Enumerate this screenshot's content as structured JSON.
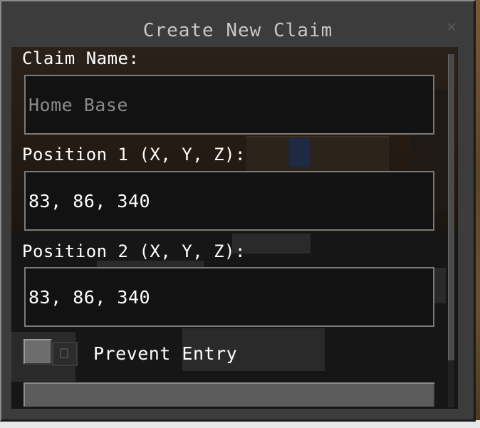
{
  "dialog": {
    "title": "Create New Claim",
    "close_icon": "close-icon"
  },
  "form": {
    "claim_name": {
      "label": "Claim Name:",
      "value": "",
      "placeholder": "Home Base"
    },
    "position1": {
      "label": "Position 1 (X, Y, Z):",
      "value": "83, 86, 340"
    },
    "position2": {
      "label": "Position 2 (X, Y, Z):",
      "value": "83, 86, 340"
    },
    "prevent_entry": {
      "label": "Prevent Entry",
      "checked": false
    }
  },
  "colors": {
    "panel": "#3c3c3c",
    "field_bg": "#121212",
    "field_border": "#7a7a7a",
    "text": "#ffffff",
    "placeholder": "#8a8a8a",
    "title": "#c6c6c6"
  }
}
